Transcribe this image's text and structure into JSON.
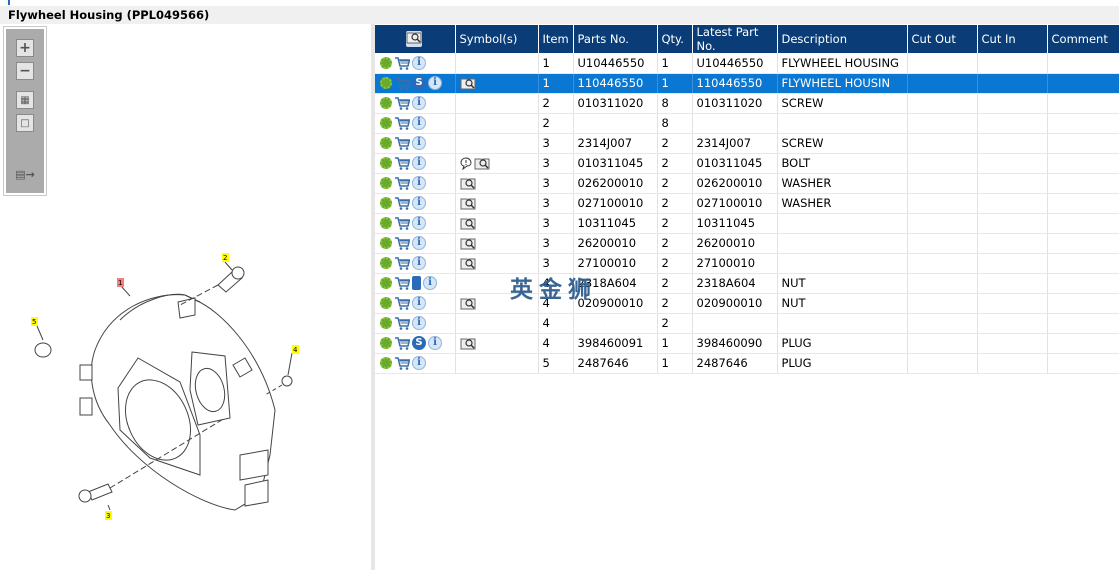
{
  "window": {
    "title": "Flywheel Housing (PPL049566)"
  },
  "toolbar": {
    "items": [
      "zoom-in",
      "zoom-out",
      "fit-all",
      "fit-window",
      "export"
    ]
  },
  "drawing": {
    "callouts": [
      "1",
      "2",
      "3",
      "4",
      "5"
    ]
  },
  "grid": {
    "columns": [
      "",
      "Symbol(s)",
      "Item",
      "Parts No.",
      "Qty.",
      "Latest Part No.",
      "Description",
      "Cut Out",
      "Cut In",
      "Comment"
    ],
    "rows": [
      {
        "icons": [
          "gear",
          "cart",
          "info"
        ],
        "symbols": [],
        "item": "1",
        "part": "U10446550",
        "qty": "1",
        "latest": "U10446550",
        "desc": "FLYWHEEL HOUSING",
        "selected": false
      },
      {
        "icons": [
          "gear",
          "cart",
          "s",
          "info"
        ],
        "symbols": [
          "book"
        ],
        "item": "1",
        "part": "110446550",
        "qty": "1",
        "latest": "110446550",
        "desc": "FLYWHEEL HOUSIN",
        "selected": true
      },
      {
        "icons": [
          "gear",
          "cart",
          "info"
        ],
        "symbols": [],
        "item": "2",
        "part": "010311020",
        "qty": "8",
        "latest": "010311020",
        "desc": "SCREW",
        "selected": false
      },
      {
        "icons": [
          "gear",
          "cart",
          "info"
        ],
        "symbols": [],
        "item": "2",
        "part": "",
        "qty": "8",
        "latest": "",
        "desc": "",
        "selected": false
      },
      {
        "icons": [
          "gear",
          "cart",
          "info"
        ],
        "symbols": [],
        "item": "3",
        "part": "2314J007",
        "qty": "2",
        "latest": "2314J007",
        "desc": "SCREW",
        "selected": false
      },
      {
        "icons": [
          "gear",
          "cart",
          "info"
        ],
        "symbols": [
          "bubble",
          "book"
        ],
        "item": "3",
        "part": "010311045",
        "qty": "2",
        "latest": "010311045",
        "desc": "BOLT",
        "selected": false
      },
      {
        "icons": [
          "gear",
          "cart",
          "info"
        ],
        "symbols": [
          "book"
        ],
        "item": "3",
        "part": "026200010",
        "qty": "2",
        "latest": "026200010",
        "desc": "WASHER",
        "selected": false
      },
      {
        "icons": [
          "gear",
          "cart",
          "info"
        ],
        "symbols": [
          "book"
        ],
        "item": "3",
        "part": "027100010",
        "qty": "2",
        "latest": "027100010",
        "desc": "WASHER",
        "selected": false
      },
      {
        "icons": [
          "gear",
          "cart",
          "info"
        ],
        "symbols": [
          "book"
        ],
        "item": "3",
        "part": "10311045",
        "qty": "2",
        "latest": "10311045",
        "desc": "",
        "selected": false
      },
      {
        "icons": [
          "gear",
          "cart",
          "info"
        ],
        "symbols": [
          "book"
        ],
        "item": "3",
        "part": "26200010",
        "qty": "2",
        "latest": "26200010",
        "desc": "",
        "selected": false
      },
      {
        "icons": [
          "gear",
          "cart",
          "info"
        ],
        "symbols": [
          "book"
        ],
        "item": "3",
        "part": "27100010",
        "qty": "2",
        "latest": "27100010",
        "desc": "",
        "selected": false
      },
      {
        "icons": [
          "gear",
          "cart",
          "manual",
          "info"
        ],
        "symbols": [],
        "item": "4",
        "part": "2318A604",
        "qty": "2",
        "latest": "2318A604",
        "desc": "NUT",
        "selected": false
      },
      {
        "icons": [
          "gear",
          "cart",
          "info"
        ],
        "symbols": [
          "book"
        ],
        "item": "4",
        "part": "020900010",
        "qty": "2",
        "latest": "020900010",
        "desc": "NUT",
        "selected": false
      },
      {
        "icons": [
          "gear",
          "cart",
          "info"
        ],
        "symbols": [],
        "item": "4",
        "part": "",
        "qty": "2",
        "latest": "",
        "desc": "",
        "selected": false
      },
      {
        "icons": [
          "gear",
          "cart",
          "s",
          "info"
        ],
        "symbols": [
          "book"
        ],
        "item": "4",
        "part": "398460091",
        "qty": "1",
        "latest": "398460090",
        "desc": "PLUG",
        "selected": false
      },
      {
        "icons": [
          "gear",
          "cart",
          "info"
        ],
        "symbols": [],
        "item": "5",
        "part": "2487646",
        "qty": "1",
        "latest": "2487646",
        "desc": "PLUG",
        "selected": false
      }
    ]
  },
  "watermark": "英金狮",
  "colors": {
    "header": "#0a3d78",
    "selected": "#0a78d2",
    "callout": "#ffff00",
    "callout_main": "#f08080"
  }
}
